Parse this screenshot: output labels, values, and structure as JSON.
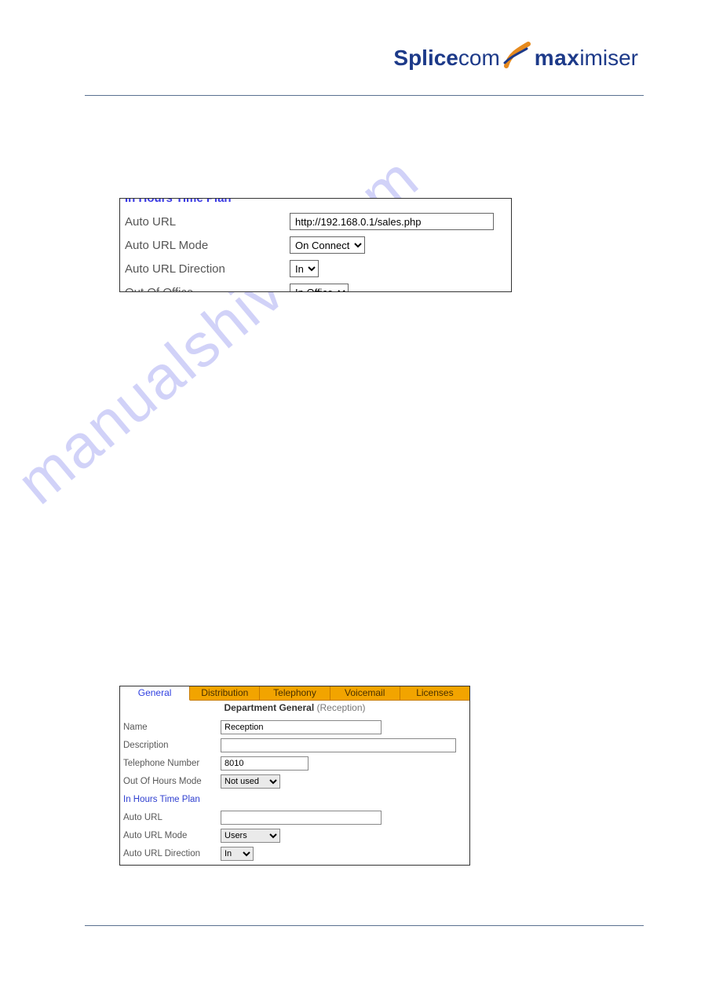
{
  "header": {
    "logo_splice": "Splice",
    "logo_com": "com",
    "logo_max": "max",
    "logo_imiser": "imiser"
  },
  "watermark": "manualshive.com",
  "panel1": {
    "heading": "In Hours Time Plan",
    "auto_url_label": "Auto URL",
    "auto_url_value": "http://192.168.0.1/sales.php",
    "auto_url_mode_label": "Auto URL Mode",
    "auto_url_mode_value": "On Connect",
    "auto_url_direction_label": "Auto URL Direction",
    "auto_url_direction_value": "In",
    "out_of_office_label": "Out Of Office",
    "out_of_office_value": "In Office"
  },
  "panel2": {
    "tabs": {
      "general": "General",
      "distribution": "Distribution",
      "telephony": "Telephony",
      "voicemail": "Voicemail",
      "licenses": "Licenses"
    },
    "title_strong": "Department General",
    "title_paren": "(Reception)",
    "name_label": "Name",
    "name_value": "Reception",
    "description_label": "Description",
    "description_value": "",
    "telephone_label": "Telephone Number",
    "telephone_value": "8010",
    "ooh_mode_label": "Out Of Hours Mode",
    "ooh_mode_value": "Not used",
    "in_hours_time_plan": "In Hours Time Plan",
    "auto_url_label": "Auto URL",
    "auto_url_value": "",
    "auto_url_mode_label": "Auto URL Mode",
    "auto_url_mode_value": "Users",
    "auto_url_direction_label": "Auto URL Direction",
    "auto_url_direction_value": "In"
  }
}
